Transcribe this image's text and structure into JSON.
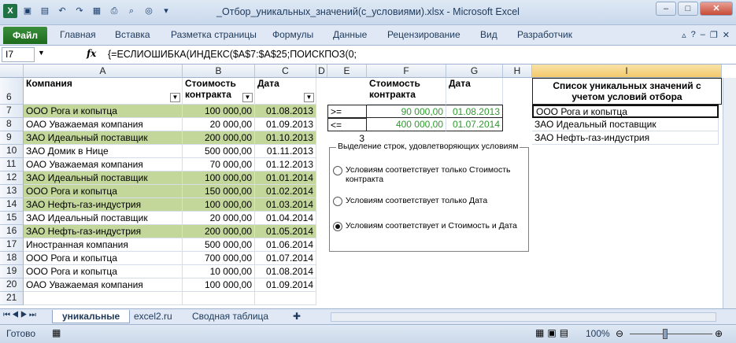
{
  "titlebar": {
    "title": "_Отбор_уникальных_значений(с_условиями).xlsx  -  Microsoft Excel",
    "logo": "X"
  },
  "ribbon": {
    "file": "Файл",
    "tabs": [
      "Главная",
      "Вставка",
      "Разметка страницы",
      "Формулы",
      "Данные",
      "Рецензирование",
      "Вид",
      "Разработчик"
    ]
  },
  "formula_bar": {
    "name_box": "I7",
    "fx": "fx",
    "formula": "{=ЕСЛИОШИБКА(ИНДЕКС($A$7:$A$25;ПОИСКПОЗ(0;"
  },
  "columns": [
    "A",
    "B",
    "C",
    "D",
    "E",
    "F",
    "G",
    "H",
    "I"
  ],
  "headers": {
    "company": "Компания",
    "cost": "Стоимость контракта",
    "date": "Дата",
    "cost2": "Стоимость контракта",
    "date2": "Дата",
    "unique": "Список уникальных значений с учетом условий отбора"
  },
  "rows": [
    {
      "n": "7",
      "company": "ООО Рога и копытца",
      "cost": "100 000,00",
      "date": "01.08.2013",
      "green": true
    },
    {
      "n": "8",
      "company": "ОАО Уважаемая компания",
      "cost": "20 000,00",
      "date": "01.09.2013",
      "green": false
    },
    {
      "n": "9",
      "company": "ЗАО Идеальный поставщик",
      "cost": "200 000,00",
      "date": "01.10.2013",
      "green": true
    },
    {
      "n": "10",
      "company": "ЗАО Домик в Нице",
      "cost": "500 000,00",
      "date": "01.11.2013",
      "green": false
    },
    {
      "n": "11",
      "company": "ОАО Уважаемая компания",
      "cost": "70 000,00",
      "date": "01.12.2013",
      "green": false
    },
    {
      "n": "12",
      "company": "ЗАО Идеальный поставщик",
      "cost": "100 000,00",
      "date": "01.01.2014",
      "green": true
    },
    {
      "n": "13",
      "company": "ООО Рога и копытца",
      "cost": "150 000,00",
      "date": "01.02.2014",
      "green": true
    },
    {
      "n": "14",
      "company": "ЗАО Нефть-газ-индустрия",
      "cost": "100 000,00",
      "date": "01.03.2014",
      "green": true
    },
    {
      "n": "15",
      "company": "ЗАО Идеальный поставщик",
      "cost": "20 000,00",
      "date": "01.04.2014",
      "green": false
    },
    {
      "n": "16",
      "company": "ЗАО Нефть-газ-индустрия",
      "cost": "200 000,00",
      "date": "01.05.2014",
      "green": true
    },
    {
      "n": "17",
      "company": "Иностранная компания",
      "cost": "500 000,00",
      "date": "01.06.2014",
      "green": false
    },
    {
      "n": "18",
      "company": "ООО Рога и копытца",
      "cost": "700 000,00",
      "date": "01.07.2014",
      "green": false
    },
    {
      "n": "19",
      "company": "ООО Рога и копытца",
      "cost": "10 000,00",
      "date": "01.08.2014",
      "green": false
    },
    {
      "n": "20",
      "company": "ОАО Уважаемая компания",
      "cost": "100 000,00",
      "date": "01.09.2014",
      "green": false
    },
    {
      "n": "21",
      "company": "",
      "cost": "",
      "date": "",
      "green": false
    }
  ],
  "criteria": [
    {
      "op": ">=",
      "cost": "90 000,00",
      "date": "01.08.2013"
    },
    {
      "op": "<=",
      "cost": "400 000,00",
      "date": "01.07.2014"
    }
  ],
  "e9": "3",
  "unique_list": [
    "ООО Рога и копытца",
    "ЗАО Идеальный поставщик",
    "ЗАО Нефть-газ-индустрия"
  ],
  "groupbox": {
    "title": "Выделение строк, удовлетворяющих условиям",
    "options": [
      "Условиям соответствует только Стоимость контракта",
      "Условиям соответствует только Дата",
      "Условиям соответствует и Стоимость и Дата"
    ],
    "selected": 2
  },
  "sheets": [
    "уникальные",
    "excel2.ru",
    "Сводная таблица"
  ],
  "status": {
    "ready": "Готово",
    "zoom": "100%"
  },
  "colors": {
    "green_fill": "#c4d79b",
    "green_text": "#2e9a2e",
    "file_tab": "#2a7d2a"
  }
}
